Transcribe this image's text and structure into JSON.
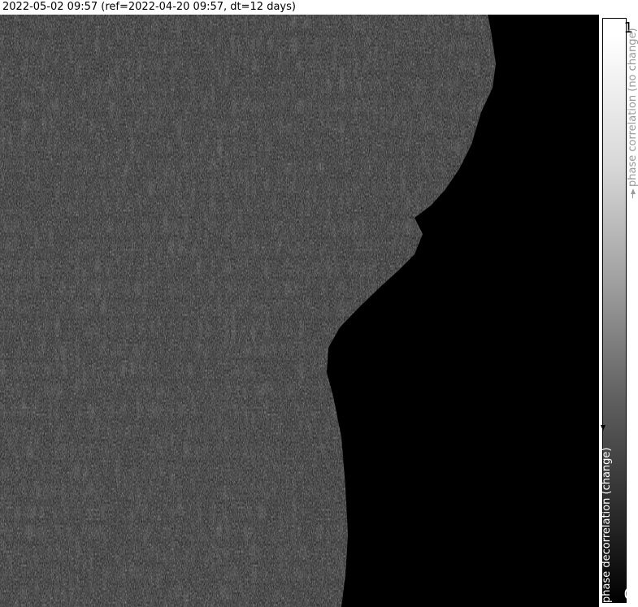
{
  "header": {
    "title": "2022-05-02 09:57 (ref=2022-04-20 09:57, dt=12 days)"
  },
  "colorbar": {
    "max_label": "1",
    "min_label": "0",
    "top_label": "phase correlation (no change)",
    "bottom_label": "phase decorrelation (change)",
    "top_color": "#ffffff",
    "bottom_color": "#000000"
  },
  "image": {
    "subject": "SAR interferometric coherence map",
    "land_texture": "speckled gray",
    "sea_color": "#000000"
  }
}
